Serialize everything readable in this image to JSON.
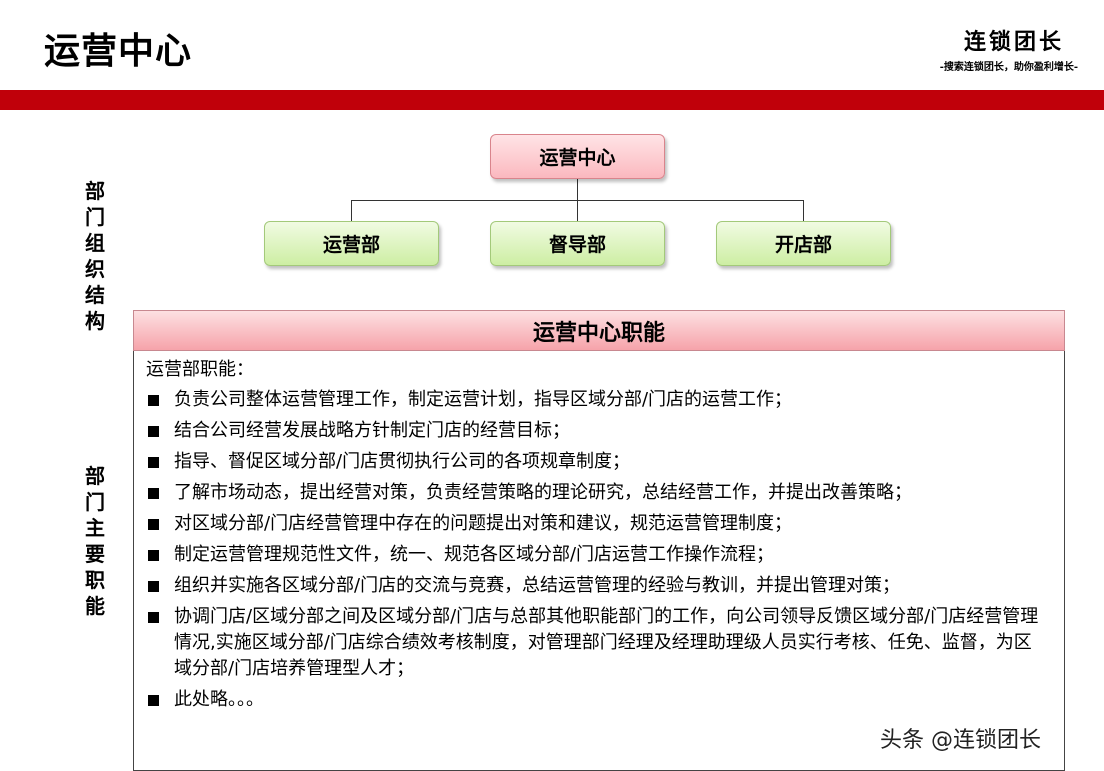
{
  "header": {
    "title": "运营中心",
    "brand_name": "连锁团长",
    "brand_slogan": "-搜索连锁团长，助你盈利增长-"
  },
  "side_labels": {
    "structure": "部门组织结构",
    "duties": "部门主要职能"
  },
  "org_chart": {
    "root": "运营中心",
    "children": [
      "运营部",
      "督导部",
      "开店部"
    ]
  },
  "duties": {
    "header": "运营中心职能",
    "intro": "运营部职能：",
    "items": [
      "负责公司整体运营管理工作，制定运营计划，指导区域分部/门店的运营工作；",
      "结合公司经营发展战略方针制定门店的经营目标；",
      "指导、督促区域分部/门店贯彻执行公司的各项规章制度；",
      "了解市场动态，提出经营对策，负责经营策略的理论研究，总结经营工作，并提出改善策略；",
      "对区域分部/门店经营管理中存在的问题提出对策和建议，规范运营管理制度；",
      "制定运营管理规范性文件，统一、规范各区域分部/门店运营工作操作流程；",
      "组织并实施各区域分部/门店的交流与竞赛，总结运营管理的经验与教训，并提出管理对策；",
      "协调门店/区域分部之间及区域分部/门店与总部其他职能部门的工作，向公司领导反馈区域分部/门店经营管理情况,实施区域分部/门店综合绩效考核制度，对管理部门经理及经理助理级人员实行考核、任免、监督，为区域分部/门店培养管理型人才；",
      "此处略。。。"
    ]
  },
  "watermark": "头条 @连锁团长"
}
